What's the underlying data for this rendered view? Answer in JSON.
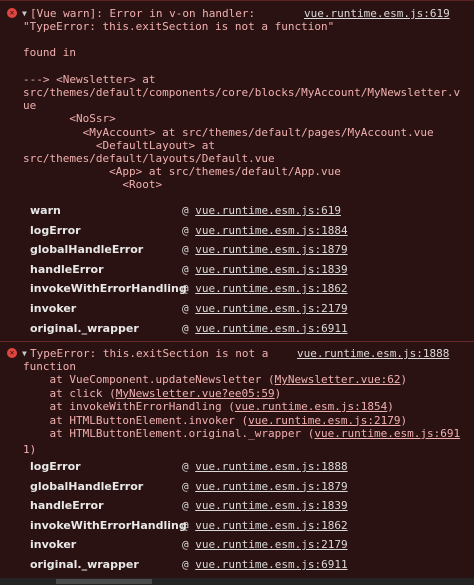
{
  "msg1": {
    "header": "[Vue warn]: Error in v-on handler:",
    "header_src": "vue.runtime.esm.js:619",
    "lines": [
      "\"TypeError: this.exitSection is not a function\"",
      "",
      "found in",
      "",
      "---> <Newsletter> at",
      "src/themes/default/components/core/blocks/MyAccount/MyNewsletter.v",
      "ue",
      "       <NoSsr>",
      "         <MyAccount> at src/themes/default/pages/MyAccount.vue",
      "           <DefaultLayout> at",
      "src/themes/default/layouts/Default.vue",
      "             <App> at src/themes/default/App.vue",
      "               <Root>"
    ],
    "stack": [
      {
        "fn": "warn",
        "src": "vue.runtime.esm.js:619"
      },
      {
        "fn": "logError",
        "src": "vue.runtime.esm.js:1884"
      },
      {
        "fn": "globalHandleError",
        "src": "vue.runtime.esm.js:1879"
      },
      {
        "fn": "handleError",
        "src": "vue.runtime.esm.js:1839"
      },
      {
        "fn": "invokeWithErrorHandling",
        "src": "vue.runtime.esm.js:1862"
      },
      {
        "fn": "invoker",
        "src": "vue.runtime.esm.js:2179"
      },
      {
        "fn": "original._wrapper",
        "src": "vue.runtime.esm.js:6911"
      }
    ]
  },
  "msg2": {
    "header": "TypeError: this.exitSection is not a",
    "header_src": "vue.runtime.esm.js:1888",
    "header_cont": "function",
    "trace": [
      {
        "pre": "    at VueComponent.updateNewsletter (",
        "link": "MyNewsletter.vue:62",
        "post": ")"
      },
      {
        "pre": "    at click (",
        "link": "MyNewsletter.vue?ee05:59",
        "post": ")"
      },
      {
        "pre": "    at invokeWithErrorHandling (",
        "link": "vue.runtime.esm.js:1854",
        "post": ")"
      },
      {
        "pre": "    at HTMLButtonElement.invoker (",
        "link": "vue.runtime.esm.js:2179",
        "post": ")"
      },
      {
        "pre": "    at HTMLButtonElement.original._wrapper (",
        "link": "vue.runtime.esm.js:691",
        "post": ""
      }
    ],
    "trace_wrap": "1)",
    "stack": [
      {
        "fn": "logError",
        "src": "vue.runtime.esm.js:1888"
      },
      {
        "fn": "globalHandleError",
        "src": "vue.runtime.esm.js:1879"
      },
      {
        "fn": "handleError",
        "src": "vue.runtime.esm.js:1839"
      },
      {
        "fn": "invokeWithErrorHandling",
        "src": "vue.runtime.esm.js:1862"
      },
      {
        "fn": "invoker",
        "src": "vue.runtime.esm.js:2179"
      },
      {
        "fn": "original._wrapper",
        "src": "vue.runtime.esm.js:6911"
      }
    ]
  },
  "at_symbol": "@",
  "icons": {
    "error": "error-x-icon",
    "expand": "expand-triangle-icon"
  }
}
